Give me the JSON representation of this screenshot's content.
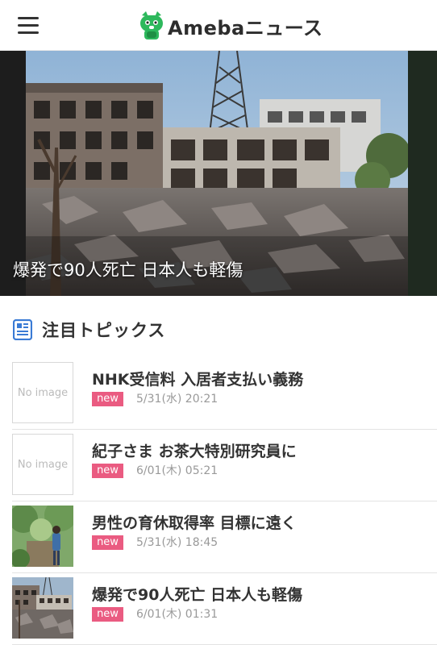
{
  "header": {
    "logo_text": "Amebaニュース",
    "menu_icon": "hamburger-menu-icon",
    "logo_icon": "ameba-pig-icon"
  },
  "hero": {
    "caption": "爆発で90人死亡 日本人も軽傷"
  },
  "section": {
    "title": "注目トピックス",
    "icon": "newspaper-icon"
  },
  "topics": [
    {
      "title": "NHK受信料 入居者支払い義務",
      "badge": "new",
      "time": "5/31(水) 20:21",
      "thumb_text": "No image"
    },
    {
      "title": "紀子さま お茶大特別研究員に",
      "badge": "new",
      "time": "6/01(木) 05:21",
      "thumb_text": "No image"
    },
    {
      "title": "男性の育休取得率 目標に遠く",
      "badge": "new",
      "time": "5/31(水) 18:45"
    },
    {
      "title": "爆発で90人死亡 日本人も軽傷",
      "badge": "new",
      "time": "6/01(木) 01:31"
    }
  ],
  "colors": {
    "badge": "#ea5b81",
    "logo_green": "#2db85c",
    "section_icon": "#3a7bd5"
  }
}
